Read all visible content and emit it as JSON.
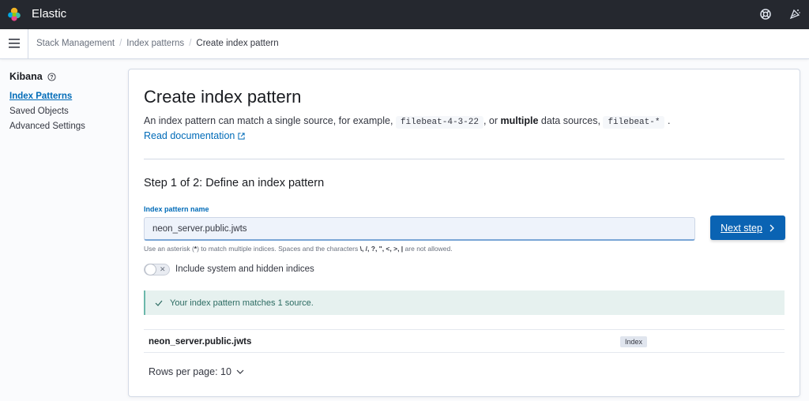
{
  "header": {
    "brand": "Elastic"
  },
  "breadcrumb": {
    "items": [
      "Stack Management",
      "Index patterns"
    ],
    "current": "Create index pattern"
  },
  "sidebar": {
    "title": "Kibana",
    "items": [
      {
        "label": "Index Patterns",
        "active": true
      },
      {
        "label": "Saved Objects",
        "active": false
      },
      {
        "label": "Advanced Settings",
        "active": false
      }
    ]
  },
  "main": {
    "title": "Create index pattern",
    "desc_part1": "An index pattern can match a single source, for example,",
    "code1": "filebeat-4-3-22",
    "desc_part2": ", or",
    "desc_bold": "multiple",
    "desc_part3": "data sources,",
    "code2": "filebeat-*",
    "desc_part4": ".",
    "doc_link": "Read documentation",
    "step_title": "Step 1 of 2: Define an index pattern",
    "field_label": "Index pattern name",
    "field_value": "neon_server.public.jwts",
    "next_label": "Next step",
    "help_part1": "Use an asterisk (",
    "help_asterisk": "*",
    "help_part2": ") to match multiple indices. Spaces and the characters",
    "help_chars": "\\, /, ?, \", <, >, |",
    "help_part3": "are not allowed.",
    "toggle_label": "Include system and hidden indices",
    "callout": "Your index pattern matches 1 source.",
    "table_rows": [
      {
        "name": "neon_server.public.jwts",
        "badge": "Index"
      }
    ],
    "rows_per_page": "Rows per page: 10"
  },
  "colors": {
    "topbar": "#25282f",
    "primary": "#006bb8",
    "button": "#0a63b3",
    "success_bg": "#e6f1ef"
  }
}
